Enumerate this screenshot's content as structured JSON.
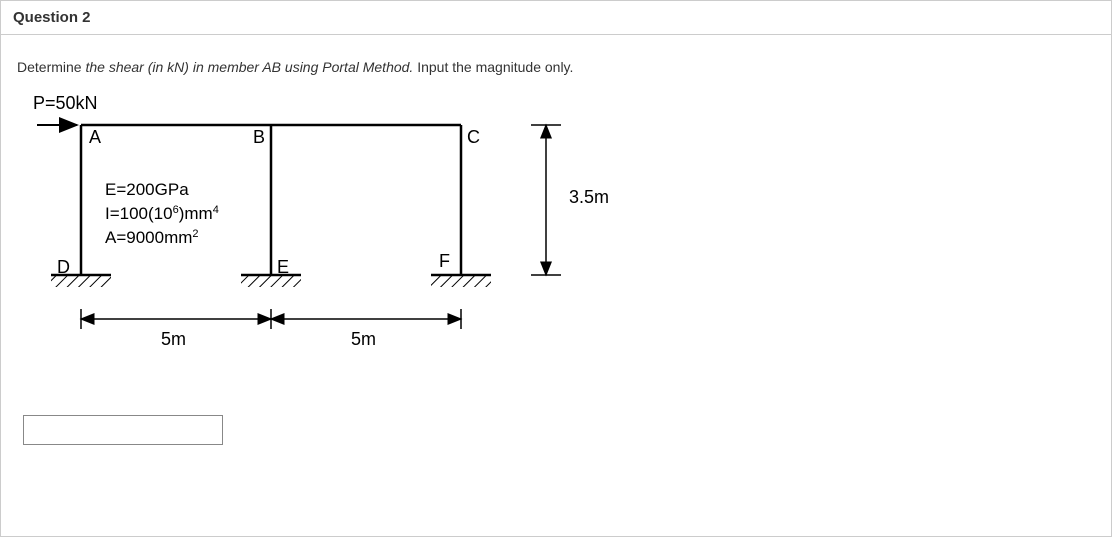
{
  "header": {
    "title": "Question 2"
  },
  "prompt": {
    "pre": "Determine ",
    "emph": "the shear (in kN) in member AB using Portal Method.",
    "post": " Input the magnitude only."
  },
  "diagram": {
    "load_label": "P=50kN",
    "nodes": {
      "A": "A",
      "B": "B",
      "C": "C",
      "D": "D",
      "E": "E",
      "F": "F"
    },
    "props": {
      "E": "E=200GPa",
      "I_pre": "I=100(10",
      "I_exp": "6",
      "I_mid": ")mm",
      "I_exp2": "4",
      "A_pre": "A=9000mm",
      "A_exp": "2"
    },
    "dims": {
      "span1": "5m",
      "span2": "5m",
      "height": "3.5m"
    }
  },
  "answer": {
    "value": ""
  }
}
